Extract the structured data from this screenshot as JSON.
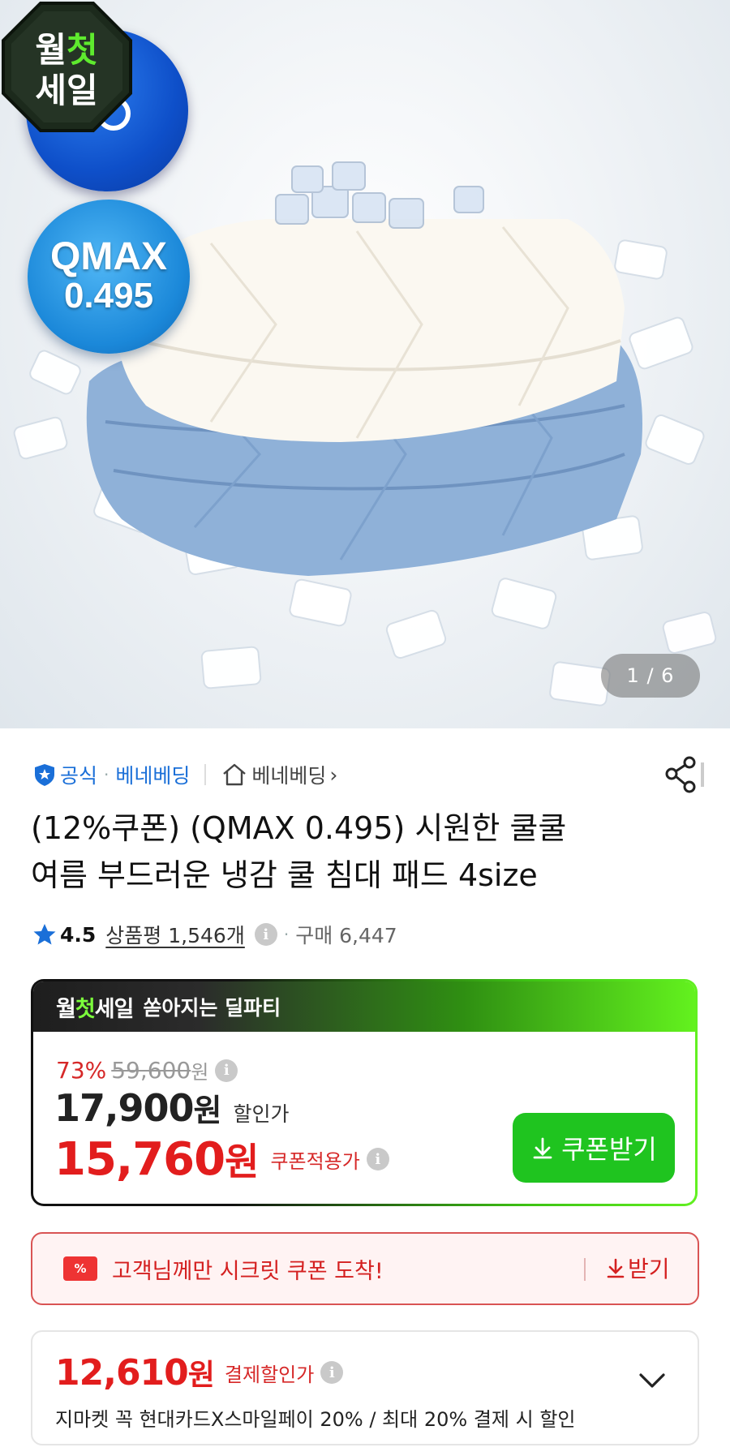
{
  "gallery": {
    "badge_qmax_line1": "QMAX",
    "badge_qmax_line2": "0.495",
    "sale_badge_line1_a": "월",
    "sale_badge_line1_b": "첫",
    "sale_badge_line2": "세일",
    "counter": "1 / 6"
  },
  "seller": {
    "official_label": "공식",
    "brand_link": "베네베딩",
    "store_link": "베네베딩"
  },
  "product": {
    "title_line1": "(12%쿠폰) (QMAX 0.495) 시원한 쿨쿨",
    "title_line2": "여름 부드러운 냉감 쿨 침대 패드 4size"
  },
  "rating": {
    "score": "4.5",
    "review_label": "상품평 1,546개",
    "purchase_label": "구매 6,447"
  },
  "deal": {
    "header_logo_a": "월",
    "header_logo_b": "첫",
    "header_logo_c": "세일",
    "header_text": "쏟아지는 딜파티",
    "discount_rate": "73%",
    "original_price": "59,600",
    "original_unit": "원",
    "sale_price": "17,900",
    "sale_unit": "원",
    "sale_label": "할인가",
    "coupon_price": "15,760",
    "coupon_unit": "원",
    "coupon_label": "쿠폰적용가",
    "coupon_button": "쿠폰받기"
  },
  "secret_coupon": {
    "ticket_icon": "%",
    "message": "고객님께만 시크릿 쿠폰 도착!",
    "action": "받기"
  },
  "payment": {
    "price": "12,610",
    "unit": "원",
    "label": "결제할인가",
    "description": "지마켓 꼭 현대카드X스마일페이 20% / 최대 20% 결제 시 할인"
  },
  "colors": {
    "accent_red": "#e21d1d",
    "link_blue": "#1a6fd8",
    "coupon_green": "#1fc41f"
  }
}
